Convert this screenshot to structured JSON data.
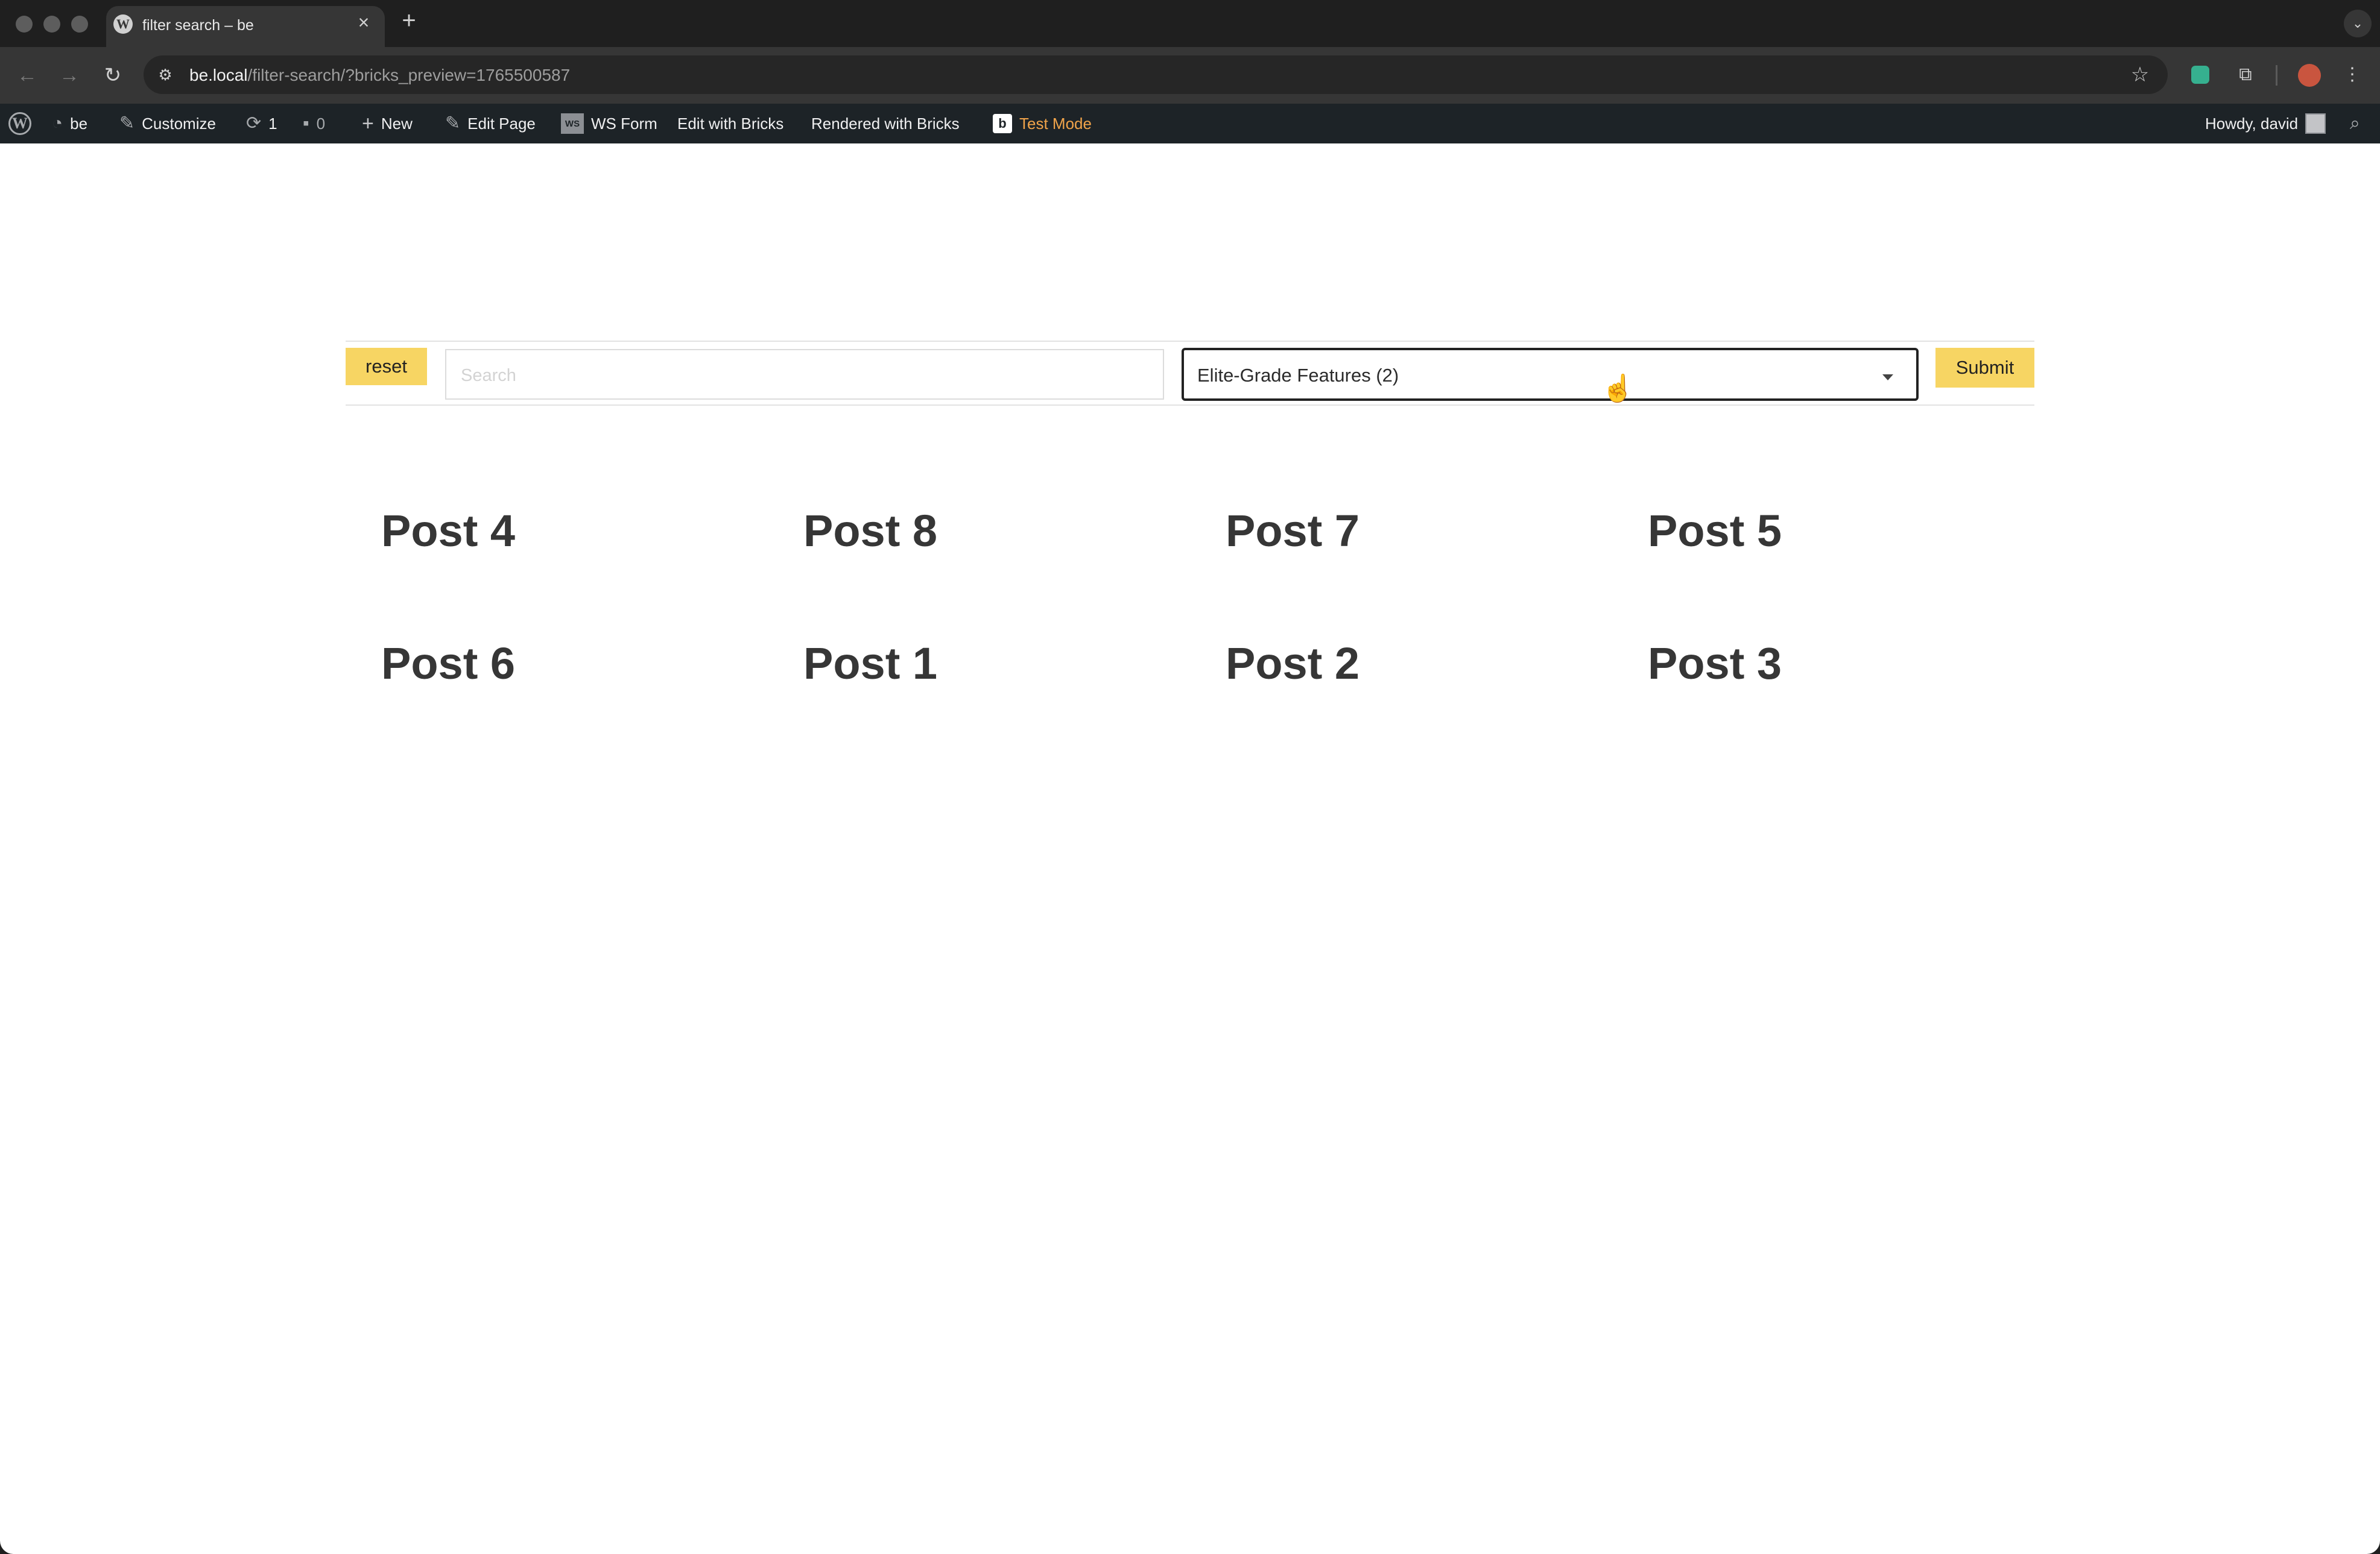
{
  "browser": {
    "tab_title": "filter search – be",
    "url_host": "be.local",
    "url_path": "/filter-search/?bricks_preview=1765500587",
    "icons": {
      "favicon": "wordpress-icon",
      "close": "close-icon",
      "new_tab": "plus-icon",
      "back": "back-arrow-icon",
      "forward": "forward-arrow-icon",
      "reload": "reload-icon",
      "site_info": "site-info-icon",
      "bookmark": "star-icon",
      "extensions": "puzzle-icon",
      "menu": "kebab-menu-icon"
    }
  },
  "adminbar": {
    "site_name": "be",
    "customize": "Customize",
    "updates_count": "1",
    "comments_count": "0",
    "new": "New",
    "edit_page": "Edit Page",
    "ws_form": "WS Form",
    "ws_logo": "WS",
    "edit_with_bricks": "Edit with Bricks",
    "rendered_with_bricks": "Rendered with Bricks",
    "test_mode": "Test Mode",
    "howdy": "Howdy, david",
    "test_mode_color": "#f1a44a",
    "background_color": "#1d2327"
  },
  "filters": {
    "reset_label": "reset",
    "search_placeholder": "Search",
    "select_value": "Elite-Grade Features (2)",
    "submit_label": "Submit",
    "button_color": "#f7d563"
  },
  "posts": [
    "Post 4",
    "Post 8",
    "Post 7",
    "Post 5",
    "Post 6",
    "Post 1",
    "Post 2",
    "Post 3"
  ]
}
